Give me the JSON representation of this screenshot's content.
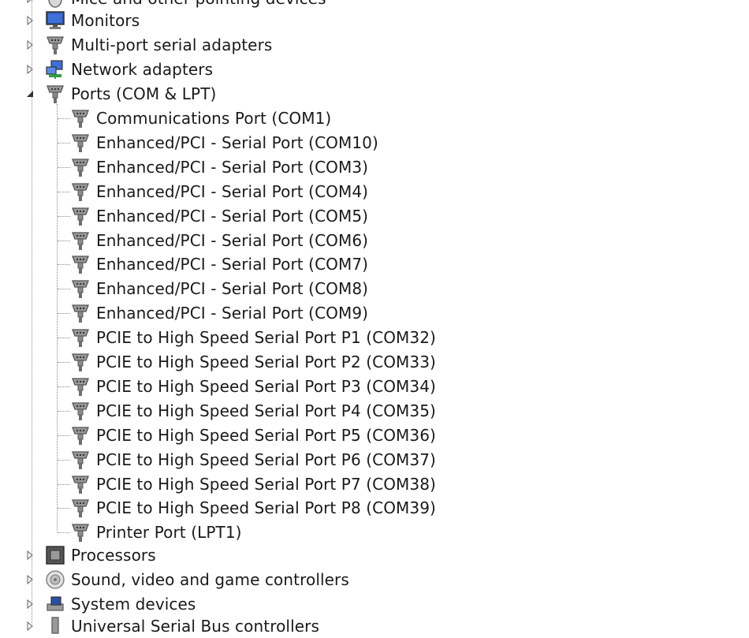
{
  "tree": {
    "top_partial": {
      "label": "Mice and other pointing devices",
      "icon": "mouse-icon"
    },
    "categories_before": [
      {
        "label": "Monitors",
        "icon": "monitor-icon",
        "expanded": false
      },
      {
        "label": "Multi-port serial adapters",
        "icon": "port-icon",
        "expanded": false
      },
      {
        "label": "Network adapters",
        "icon": "network-adapter-icon",
        "expanded": false
      }
    ],
    "ports": {
      "label": "Ports (COM & LPT)",
      "icon": "port-icon",
      "expanded": true,
      "children": [
        {
          "label": "Communications Port (COM1)"
        },
        {
          "label": "Enhanced/PCI - Serial Port (COM10)"
        },
        {
          "label": "Enhanced/PCI - Serial Port (COM3)"
        },
        {
          "label": "Enhanced/PCI - Serial Port (COM4)"
        },
        {
          "label": "Enhanced/PCI - Serial Port (COM5)"
        },
        {
          "label": "Enhanced/PCI - Serial Port (COM6)"
        },
        {
          "label": "Enhanced/PCI - Serial Port (COM7)"
        },
        {
          "label": "Enhanced/PCI - Serial Port (COM8)"
        },
        {
          "label": "Enhanced/PCI - Serial Port (COM9)"
        },
        {
          "label": "PCIE to High Speed Serial Port P1 (COM32)"
        },
        {
          "label": "PCIE to High Speed Serial Port P2 (COM33)"
        },
        {
          "label": "PCIE to High Speed Serial Port P3 (COM34)"
        },
        {
          "label": "PCIE to High Speed Serial Port P4 (COM35)"
        },
        {
          "label": "PCIE to High Speed Serial Port P5 (COM36)"
        },
        {
          "label": "PCIE to High Speed Serial Port P6 (COM37)"
        },
        {
          "label": "PCIE to High Speed Serial Port P7 (COM38)"
        },
        {
          "label": "PCIE to High Speed Serial Port P8 (COM39)"
        },
        {
          "label": "Printer Port (LPT1)"
        }
      ]
    },
    "categories_after": [
      {
        "label": "Processors",
        "icon": "processor-icon",
        "expanded": false
      },
      {
        "label": "Sound, video and game controllers",
        "icon": "speaker-icon",
        "expanded": false
      },
      {
        "label": "System devices",
        "icon": "system-devices-icon",
        "expanded": false
      }
    ],
    "bottom_partial": {
      "label": "Universal Serial Bus controllers",
      "icon": "usb-icon"
    }
  },
  "colors": {
    "text": "#1a1a1a",
    "connector": "#8c8c8c",
    "expander": "#7a7a7a",
    "port_icon": "#6e6e6e"
  }
}
